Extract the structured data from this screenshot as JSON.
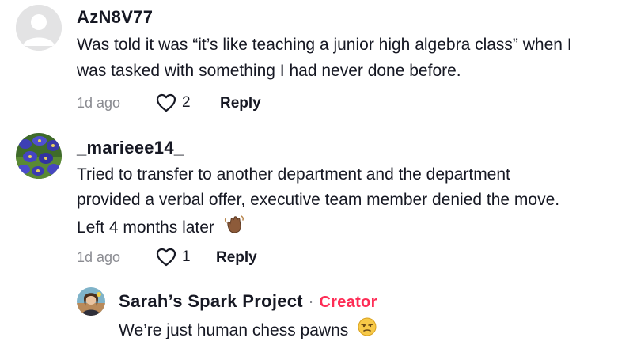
{
  "comments": [
    {
      "username": "AzN8V77",
      "lines": [
        "Was told it was “it’s like teaching a junior high algebra class” when I",
        "was tasked with something I had never done before."
      ],
      "time": "1d ago",
      "likes": "2",
      "reply_label": "Reply"
    },
    {
      "username": "_marieee14_",
      "lines": [
        "Tried to transfer to another department and the department",
        "provided a verbal offer, executive team member denied the move.",
        "Left 4 months later"
      ],
      "emoji": "waving-hand-medium-dark",
      "time": "1d ago",
      "likes": "1",
      "reply_label": "Reply"
    }
  ],
  "reply": {
    "username": "Sarah’s Spark Project",
    "separator": "·",
    "creator_label": "Creator",
    "text": "We’re just human chess pawns",
    "emoji": "unamused-face"
  },
  "colors": {
    "text": "#161823",
    "muted": "#8a8b91",
    "creator": "#fe2c55"
  }
}
